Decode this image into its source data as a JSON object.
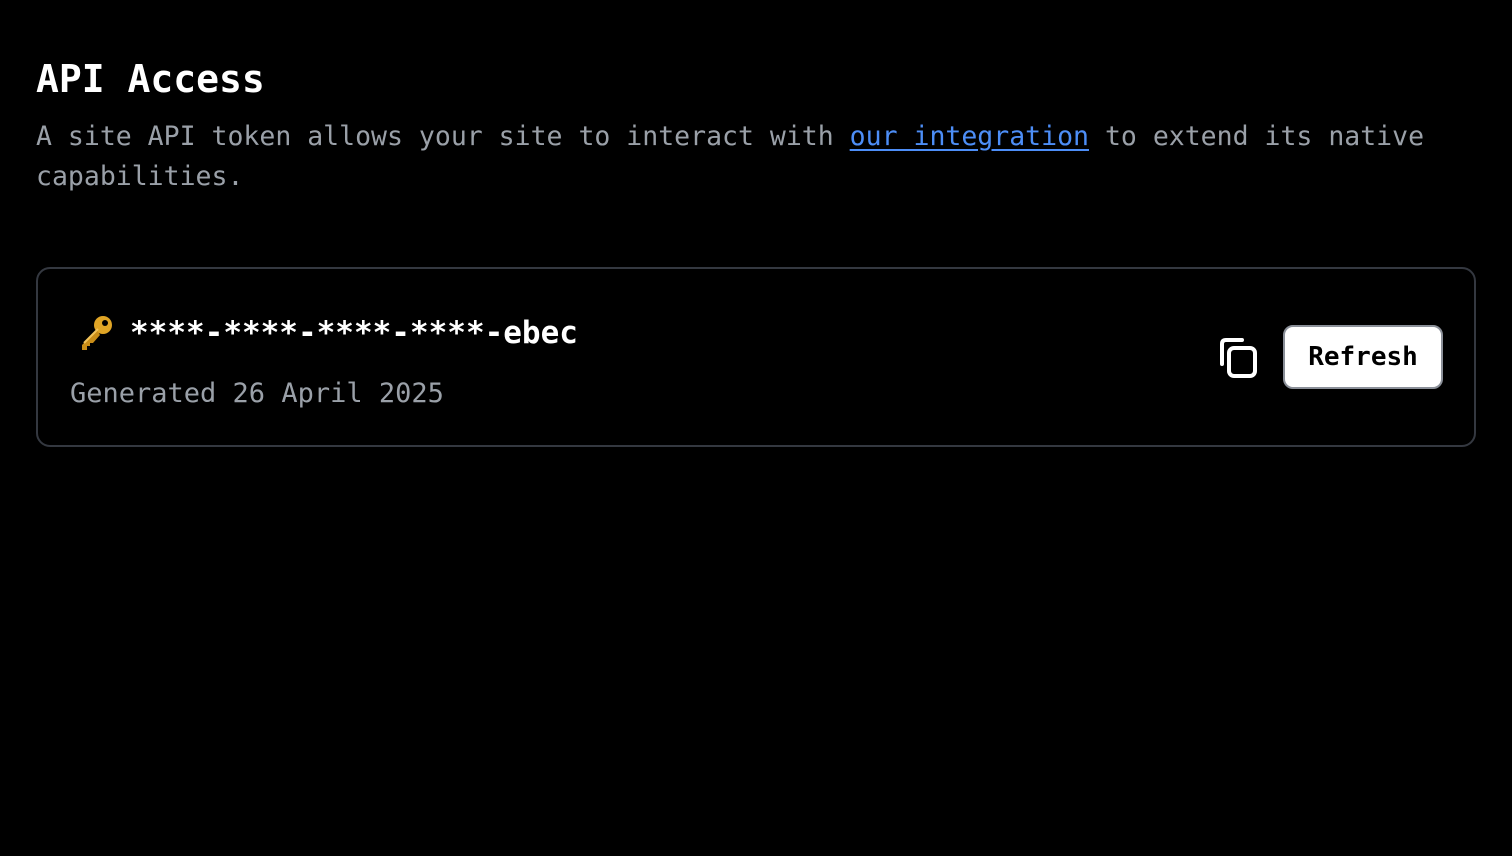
{
  "header": {
    "title": "API Access",
    "description_before": "A site API token allows your site to interact with ",
    "description_link": "our integration",
    "description_after": " to extend its native capabilities."
  },
  "token": {
    "icon": "key-icon",
    "masked_value": "****-****-****-****-ebec",
    "generated_label": "Generated 26 April 2025",
    "copy_icon": "copy-icon",
    "refresh_label": "Refresh"
  },
  "colors": {
    "background": "#000000",
    "text_primary": "#ffffff",
    "text_muted": "#9aa0a8",
    "link": "#4d8ef7",
    "card_border": "#343840",
    "key_gold": "#e0a526"
  }
}
